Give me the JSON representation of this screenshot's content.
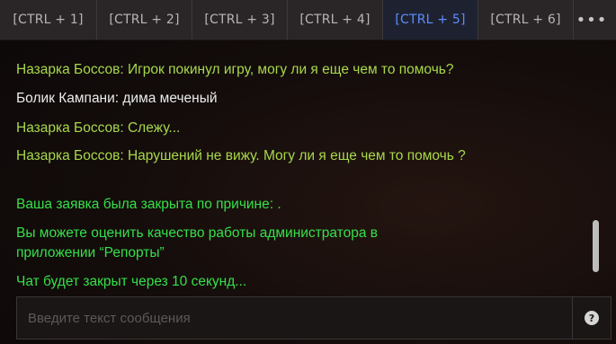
{
  "tabs": [
    {
      "label": "[CTRL + 1]",
      "active": false
    },
    {
      "label": "[CTRL + 2]",
      "active": false
    },
    {
      "label": "[CTRL + 3]",
      "active": false
    },
    {
      "label": "[CTRL + 4]",
      "active": false
    },
    {
      "label": "[CTRL + 5]",
      "active": true
    },
    {
      "label": "[CTRL + 6]",
      "active": false
    }
  ],
  "more_label": "•••",
  "messages": [
    {
      "text": "Назарка Боссов: Игрок покинул игру, могу ли я еще чем то помочь?",
      "color": "#a8d84a"
    },
    {
      "text": "Болик Кампани: дима меченый",
      "color": "#ececec"
    },
    {
      "text": "Назарка Боссов: Слежу...",
      "color": "#a8d84a"
    },
    {
      "text": "Назарка Боссов: Нарушений не вижу. Могу ли я еще чем то помочь ?",
      "color": "#a8d84a"
    },
    {
      "text": "Ваша заявка была закрыта по причине: .",
      "color": "#36e04a"
    },
    {
      "text": "Вы можете оценить качество работы администратора в приложении “Репорты”",
      "color": "#36e04a"
    },
    {
      "text": "Чат будет закрыт через 10 секунд...",
      "color": "#36e04a"
    }
  ],
  "input": {
    "placeholder": "Введите текст сообщения",
    "value": ""
  },
  "help_icon": "question-icon",
  "help_glyph": "?"
}
